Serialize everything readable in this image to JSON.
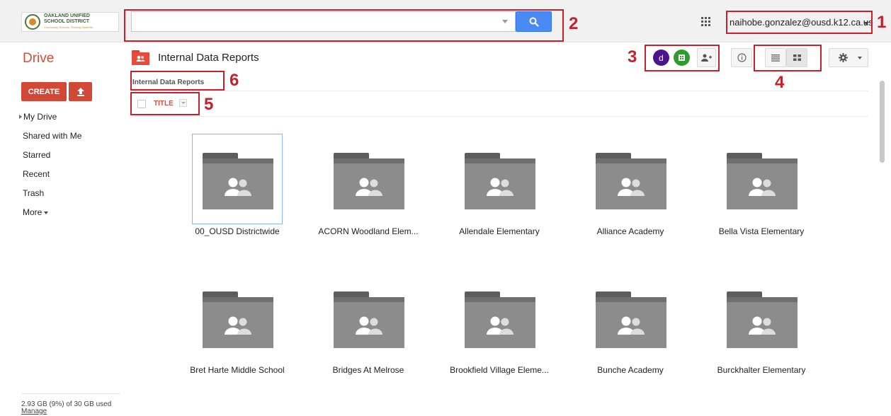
{
  "header": {
    "logo": {
      "line1": "OAKLAND UNIFIED",
      "line2": "SCHOOL DISTRICT",
      "tagline": "Community Schools, Thriving Students"
    },
    "search": {
      "value": "",
      "placeholder": ""
    },
    "search_button_icon": "search-icon",
    "apps_icon": "apps-grid-icon",
    "account": "naihobe.gonzalez@ousd.k12.ca.us"
  },
  "sidebar": {
    "title": "Drive",
    "create_label": "CREATE",
    "upload_icon": "upload-icon",
    "items": [
      {
        "label": "My Drive"
      },
      {
        "label": "Shared with Me"
      },
      {
        "label": "Starred"
      },
      {
        "label": "Recent"
      },
      {
        "label": "Trash"
      },
      {
        "label": "More"
      }
    ],
    "storage": "2.93 GB (9%) of 30 GB used",
    "manage": "Manage"
  },
  "content": {
    "folder_title": "Internal Data Reports",
    "breadcrumb": "Internal Data Reports",
    "sharers": [
      {
        "initial": "d",
        "color": "#4a148c"
      },
      {
        "initial": "",
        "color": "#2e9b2e"
      }
    ],
    "title_column": "TITLE",
    "folders": [
      {
        "name": "00_OUSD Districtwide",
        "selected": true
      },
      {
        "name": "ACORN Woodland Elem..."
      },
      {
        "name": "Allendale Elementary"
      },
      {
        "name": "Alliance Academy"
      },
      {
        "name": "Bella Vista Elementary"
      },
      {
        "name": "Bret Harte Middle School"
      },
      {
        "name": "Bridges At Melrose"
      },
      {
        "name": "Brookfield Village Eleme..."
      },
      {
        "name": "Bunche Academy"
      },
      {
        "name": "Burckhalter Elementary"
      }
    ]
  },
  "annotations": [
    "1",
    "2",
    "3",
    "4",
    "5",
    "6"
  ],
  "colors": {
    "accent": "#dd4b39",
    "search_button": "#4a8af4",
    "annotation": "#c8202a",
    "folder": "#8c8c8c"
  }
}
